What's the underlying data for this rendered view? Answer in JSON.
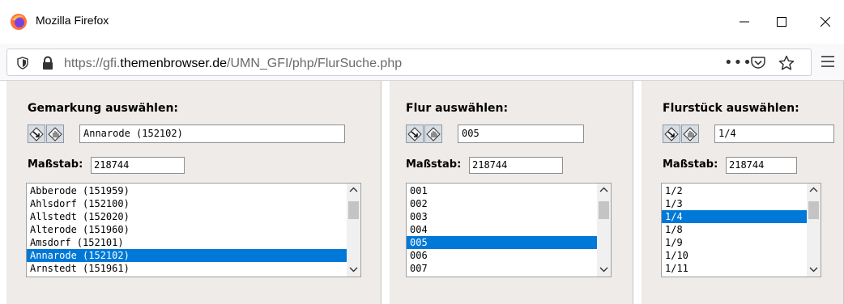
{
  "window": {
    "title": "Mozilla Firefox",
    "icons": {
      "app": "firefox-icon",
      "minimize": "minimize-icon",
      "maximize": "maximize-icon",
      "close": "close-icon"
    }
  },
  "address_bar": {
    "url_prefix": "https://gfi.",
    "url_domain": "themenbrowser.de",
    "url_path": "/UMN_GFI/php/FlurSuche.php",
    "more": "•••",
    "icons": {
      "shield": "shield-icon",
      "lock": "lock-icon",
      "pocket": "pocket-icon",
      "bookmark": "star-icon",
      "menu": "hamburger-menu-icon"
    }
  },
  "panels": {
    "gemarkung": {
      "heading": "Gemarkung auswählen:",
      "value": "Annarode (152102)",
      "scale_label": "Maßstab:",
      "scale_value": "218744",
      "items": [
        "Abberode (151959)",
        "Ahlsdorf (152100)",
        "Allstedt (152020)",
        "Alterode (151960)",
        "Amsdorf (152101)",
        "Annarode (152102)",
        "Arnstedt (151961)"
      ],
      "selected_index": 5,
      "scroll_fraction": 0.0
    },
    "flur": {
      "heading": "Flur auswählen:",
      "value": "005",
      "scale_label": "Maßstab:",
      "scale_value": "218744",
      "items": [
        "001",
        "002",
        "003",
        "004",
        "005",
        "006",
        "007"
      ],
      "selected_index": 4,
      "scroll_fraction": 0.0
    },
    "flurstueck": {
      "heading": "Flurstück auswählen:",
      "value": "1/4",
      "scale_label": "Maßstab:",
      "scale_value": "218744",
      "items": [
        "1/2",
        "1/3",
        "1/4",
        "1/8",
        "1/9",
        "1/10",
        "1/11"
      ],
      "selected_index": 2,
      "scroll_fraction": 0.0
    }
  },
  "tool_icons": [
    "zoom-to-selection-icon",
    "pan-hand-icon"
  ],
  "colors": {
    "selection": "#0078d7",
    "panel_bg": "#eeebe8"
  }
}
